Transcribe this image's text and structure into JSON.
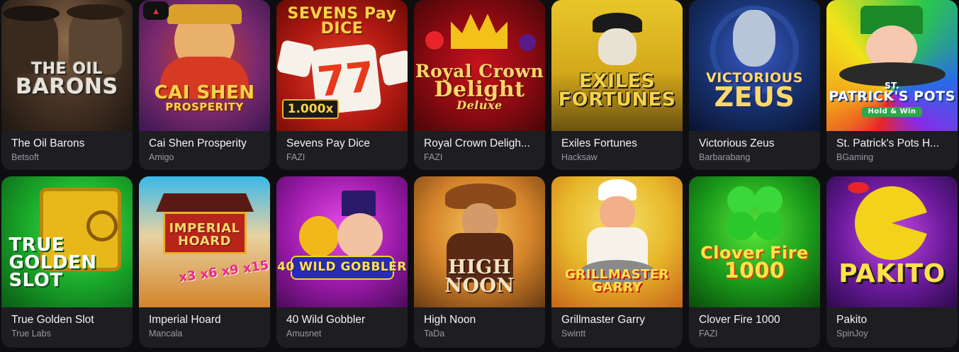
{
  "games": [
    {
      "title": "The Oil Barons",
      "provider": "Betsoft",
      "logo_lines": [
        "THE OIL",
        "BARONS"
      ],
      "art": "oil"
    },
    {
      "title": "Cai Shen Prosperity",
      "provider": "Amigo",
      "logo_lines": [
        "CAI SHEN",
        "PROSPERITY"
      ],
      "art": "caishen"
    },
    {
      "title": "Sevens Pay Dice",
      "provider": "FAZI",
      "logo_lines": [
        "SEVENS Pay",
        "DICE"
      ],
      "badge": "1.000x",
      "art": "sevens"
    },
    {
      "title": "Royal Crown Delight Deluxe",
      "title_display": "Royal Crown Deligh...",
      "provider": "FAZI",
      "logo_lines": [
        "Royal Crown",
        "Delight",
        "Deluxe"
      ],
      "art": "royal"
    },
    {
      "title": "Exiles Fortunes",
      "provider": "Hacksaw",
      "logo_lines": [
        "EXILES",
        "FORTUNES"
      ],
      "art": "exiles"
    },
    {
      "title": "Victorious Zeus",
      "provider": "Barbarabang",
      "logo_lines": [
        "VICTORIOUS",
        "ZEUS"
      ],
      "art": "zeus"
    },
    {
      "title": "St. Patrick's Pots Hold & Win",
      "title_display": "St. Patrick's Pots H...",
      "provider": "BGaming",
      "logo_lines": [
        "ST.",
        "PATRICK'S POTS",
        "Hold & Win"
      ],
      "art": "patrick"
    },
    {
      "title": "True Golden Slot",
      "provider": "True Labs",
      "logo_lines": [
        "TRUE",
        "GOLDEN",
        "SLOT"
      ],
      "art": "true"
    },
    {
      "title": "Imperial Hoard",
      "provider": "Mancala",
      "logo_lines": [
        "IMPERIAL",
        "HOARD"
      ],
      "multipliers": "x3 x6 x9 x15",
      "art": "imperial"
    },
    {
      "title": "40 Wild Gobbler",
      "provider": "Amusnet",
      "logo_lines": [
        "40 WILD GOBBLER"
      ],
      "art": "gobbler"
    },
    {
      "title": "High Noon",
      "provider": "TaDa",
      "logo_lines": [
        "HIGH NOON"
      ],
      "art": "noon"
    },
    {
      "title": "Grillmaster Garry",
      "provider": "Swintt",
      "logo_lines": [
        "GRILLMASTER",
        "GARRY"
      ],
      "art": "grill"
    },
    {
      "title": "Clover Fire 1000",
      "provider": "FAZI",
      "logo_lines": [
        "Clover Fire",
        "1000"
      ],
      "art": "clover"
    },
    {
      "title": "Pakito",
      "provider": "SpinJoy",
      "logo_lines": [
        "PAKITO"
      ],
      "art": "pakito"
    }
  ],
  "colors": {
    "page_bg": "#0e0e10",
    "card_bg": "#1d1d22",
    "title": "#f4f4f6",
    "provider": "#9a9aa3"
  }
}
